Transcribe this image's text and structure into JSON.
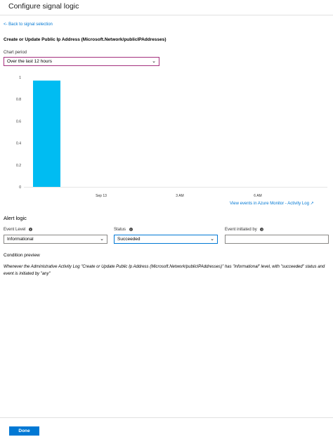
{
  "header": {
    "title": "Configure signal logic"
  },
  "back_link": "<- Back to signal selection",
  "section_heading": "Create or Update Public Ip Address (Microsoft.Network/publicIPAddresses)",
  "chart_period": {
    "label": "Chart period",
    "value": "Over the last 12 hours"
  },
  "chart_data": {
    "type": "bar",
    "title": "",
    "xlabel": "",
    "ylabel": "",
    "ylim": [
      0,
      1
    ],
    "yticks": [
      "1",
      "0.8",
      "0.6",
      "0.4",
      "0.2",
      "0"
    ],
    "xticks": [
      "Sep 13",
      "3 AM",
      "6 AM"
    ],
    "bar_color": "#00bcf2",
    "bars": [
      {
        "label": "",
        "value": 0.97
      }
    ],
    "grid": false
  },
  "activity_link": "View events in Azure Monitor - Activity Log",
  "alert_logic": {
    "heading": "Alert logic",
    "event_level": {
      "label": "Event Level",
      "value": "Informational"
    },
    "status": {
      "label": "Status",
      "value": "Succeeded"
    },
    "initiated_by": {
      "label": "Event initiated by",
      "value": ""
    }
  },
  "condition_preview": {
    "heading": "Condition preview",
    "text": "Whenever the Administrative Activity Log \"Create or Update Public Ip Address (Microsoft.Network/publicIPAddresses)\" has \"informational\" level, with \"succeeded\" status and event is initiated by \"any\""
  },
  "done_label": "Done",
  "colors": {
    "accent": "#0078d4",
    "bar": "#00bcf2",
    "active_border": "#a4317e"
  }
}
